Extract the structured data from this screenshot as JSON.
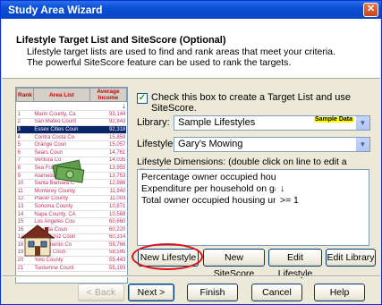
{
  "window": {
    "title": "Study Area Wizard",
    "close_glyph": "✕"
  },
  "header": {
    "heading": "Lifestyle Target List and SiteScore (Optional)",
    "description": "Lifestyle target lists are used to find and rank areas that meet your criteria.  The powerful SiteScore feature can be used to rank the targets."
  },
  "preview": {
    "columns": [
      "Rank",
      "Area List",
      "Average Income"
    ],
    "sort_glyph": "↓",
    "rows": [
      {
        "rank": "1",
        "area": "Marin County, Ca",
        "value": "93,144"
      },
      {
        "rank": "2",
        "area": "San Mateo Count",
        "value": "92,843"
      },
      {
        "rank": "3",
        "area": "Essex Cities Coun",
        "value": "92,318"
      },
      {
        "rank": "4",
        "area": "Contra Costa Co",
        "value": "15,859"
      },
      {
        "rank": "5",
        "area": "Orange Coun",
        "value": "15,057"
      },
      {
        "rank": "6",
        "area": "Sears Coun",
        "value": "14,761"
      },
      {
        "rank": "7",
        "area": "Ventura Co",
        "value": "14,035"
      },
      {
        "rank": "8",
        "area": "Sea Fra",
        "value": "13,955"
      },
      {
        "rank": "9",
        "area": "Alameda County",
        "value": "13,753"
      },
      {
        "rank": "10",
        "area": "Santa Barbara C",
        "value": "12,986"
      },
      {
        "rank": "11",
        "area": "Monterey County",
        "value": "11,940"
      },
      {
        "rank": "12",
        "area": "Placer County",
        "value": "11,003"
      },
      {
        "rank": "13",
        "area": "Sonoma County",
        "value": "10,871"
      },
      {
        "rank": "14",
        "area": "Napa County, CA",
        "value": "10,569"
      },
      {
        "rank": "15",
        "area": "Los Angeles Cou",
        "value": "60,660"
      },
      {
        "rank": "16",
        "area": "Nevada Coun",
        "value": "60,220"
      },
      {
        "rank": "17",
        "area": "Santa Cruz Coun",
        "value": "60,314"
      },
      {
        "rank": "18",
        "area": "Sacramento Co",
        "value": "59,766"
      },
      {
        "rank": "19",
        "area": "Solano Coun",
        "value": "58,595"
      },
      {
        "rank": "20",
        "area": "Yolo County",
        "value": "55,443"
      },
      {
        "rank": "21",
        "area": "Tuolumne Count",
        "value": "55,193"
      }
    ]
  },
  "options": {
    "checkbox_label": "Check this box to create a Target List and use SiteScore.",
    "checkbox_checked": true,
    "check_glyph": "✓",
    "library_label": "Library:",
    "library_value": "Sample Lifestyles",
    "sample_badge": "Sample Data",
    "lifestyle_label": "Lifestyle:",
    "lifestyle_value": "Gary's Mowing",
    "dropdown_glyph": "▼",
    "dimensions_label": "Lifestyle Dimensions: (double click on line to edit a dimension)",
    "dimensions": [
      {
        "name": "Percentage owner occupied housing u",
        "op": "",
        "value": ""
      },
      {
        "name": "Expenditure per household on garden:",
        "op": "↓",
        "value": ""
      },
      {
        "name": "Total owner occupied housing units",
        "op": ">=",
        "value": "1"
      }
    ]
  },
  "buttons": {
    "new_lifestyle": "New Lifestyle",
    "new_sitescore": "New SiteScore",
    "edit_lifestyle": "Edit Lifestyle",
    "edit_library": "Edit Library",
    "back": "< Back",
    "next": "Next >",
    "finish": "Finish",
    "cancel": "Cancel",
    "help": "Help"
  },
  "colors": {
    "highlight": "#e0101a",
    "title_bar": "#0846c6",
    "selected_row": "#0a246a"
  }
}
